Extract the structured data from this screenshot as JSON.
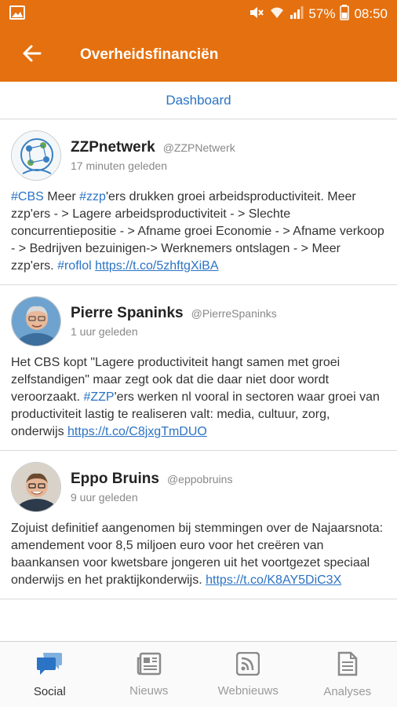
{
  "status_bar": {
    "battery": "57%",
    "time": "08:50"
  },
  "app_bar": {
    "title": "Overheidsfinanciën"
  },
  "subnav": {
    "link": "Dashboard"
  },
  "tweets": [
    {
      "name": "ZZPnetwerk",
      "handle": "@ZZPNetwerk",
      "time": "17 minuten geleden",
      "text_parts": [
        {
          "t": "#CBS",
          "k": "tag"
        },
        {
          "t": " Meer ",
          "k": "plain"
        },
        {
          "t": "#zzp",
          "k": "tag"
        },
        {
          "t": "'ers drukken groei arbeidsproductiviteit. Meer zzp'ers - > Lagere arbeidsproductiviteit - > Slechte concurrentiepositie - > Afname groei Economie - > Afname verkoop - > Bedrijven bezuinigen-> Werknemers ontslagen - > Meer zzp'ers. ",
          "k": "plain"
        },
        {
          "t": "#roflol",
          "k": "tag"
        },
        {
          "t": " ",
          "k": "plain"
        },
        {
          "t": "https://t.co/5zhftgXiBA",
          "k": "link"
        }
      ]
    },
    {
      "name": "Pierre Spaninks",
      "handle": "@PierreSpaninks",
      "time": "1 uur geleden",
      "text_parts": [
        {
          "t": "Het CBS kopt \"Lagere productiviteit hangt samen met groei zelfstandigen\" maar zegt ook dat die daar niet door wordt veroorzaakt. ",
          "k": "plain"
        },
        {
          "t": "#ZZP",
          "k": "tag"
        },
        {
          "t": "'ers werken nl vooral in sectoren waar groei van productiviteit lastig te realiseren valt: media, cultuur, zorg, onderwijs ",
          "k": "plain"
        },
        {
          "t": "https://t.co/C8jxgTmDUO",
          "k": "link"
        }
      ]
    },
    {
      "name": "Eppo Bruins",
      "handle": "@eppobruins",
      "time": "9 uur geleden",
      "text_parts": [
        {
          "t": "Zojuist definitief aangenomen bij stemmingen over de Najaarsnota: amendement voor 8,5 miljoen euro voor het creëren van baankansen voor kwetsbare jongeren uit het voortgezet speciaal onderwijs en het praktijkonderwijs. ",
          "k": "plain"
        },
        {
          "t": "https://t.co/K8AY5DiC3X",
          "k": "link"
        }
      ]
    }
  ],
  "bottom_nav": [
    {
      "label": "Social",
      "icon": "chat-bubbles-icon",
      "active": true
    },
    {
      "label": "Nieuws",
      "icon": "newspaper-icon",
      "active": false
    },
    {
      "label": "Webnieuws",
      "icon": "rss-icon",
      "active": false
    },
    {
      "label": "Analyses",
      "icon": "document-icon",
      "active": false
    }
  ],
  "colors": {
    "brand": "#e5700f",
    "link": "#2b73c4",
    "active_icon": "#2b73c4",
    "inactive": "#9a9a9a"
  }
}
